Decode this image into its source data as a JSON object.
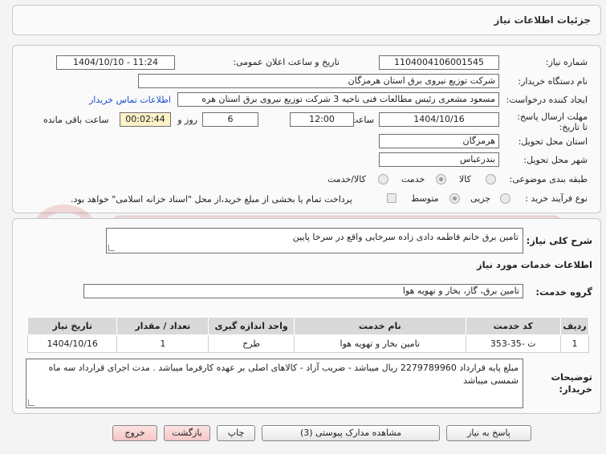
{
  "header": {
    "title": "جزئیات اطلاعات نیاز"
  },
  "fields": {
    "need_number_label": "شماره نیاز:",
    "need_number": "1104004106001545",
    "announce_label": "تاریخ و ساعت اعلان عمومی:",
    "announce_value": "1404/10/10 - 11:24",
    "buyer_org_label": "نام دستگاه خریدار:",
    "buyer_org": "شرکت توزیع نیروی برق استان هرمزگان",
    "creator_label": "ایجاد کننده درخواست:",
    "creator": "مسعود مشعری رئیس مطالعات فنی ناحیه 3 شرکت توزیع نیروی برق استان هره",
    "contact_link": "اطلاعات تماس خریدار",
    "deadline_label": "مهلت ارسال پاسخ: تا تاریخ:",
    "deadline_date": "1404/10/16",
    "time_label": "ساعت",
    "deadline_time": "12:00",
    "days_value": "6",
    "days_label": "روز و",
    "remaining_value": "00:02:44",
    "remaining_label": "ساعت باقی مانده",
    "province_label": "استان محل تحویل:",
    "province": "هرمزگان",
    "city_label": "شهر محل تحویل:",
    "city": "بندرعباس",
    "category_label": "طبقه بندی موضوعی:",
    "category_options": [
      "کالا",
      "خدمت",
      "کالا/خدمت"
    ],
    "process_label": "نوع فرآیند خرید :",
    "process_options": [
      "جزیی",
      "متوسط"
    ],
    "payment_note": "پرداخت تمام یا بخشی از مبلغ خرید،از محل \"اسناد خزانه اسلامی\" خواهد بود."
  },
  "summary": {
    "label": "شرح کلی نیاز:",
    "value": "تامین برق خانم فاطمه دادی زاده سرخایی واقع در سرخا پایین"
  },
  "services": {
    "section_title": "اطلاعات خدمات مورد نیاز",
    "group_label": "گروه خدمت:",
    "group_value": "تامین برق، گاز، بخار و تهویه هوا",
    "table": {
      "headers": [
        "ردیف",
        "کد خدمت",
        "نام خدمت",
        "واحد اندازه گیری",
        "تعداد / مقدار",
        "تاریخ نیاز"
      ],
      "rows": [
        [
          "1",
          "ت -35-353",
          "تامین بخار و تهویه هوا",
          "طرح",
          "1",
          "1404/10/16"
        ]
      ]
    }
  },
  "buyer_notes": {
    "label": "توضیحات خریدار:",
    "value": "مبلغ پایه قرارداد 2279789960 ریال میباشد - ضریب آزاد - کالاهای اصلی بر عهده کارفرما میباشد . مدت اجرای قرارداد سه ماه شمسی میباشد"
  },
  "buttons": {
    "reply": "پاسخ به نیاز",
    "attachments": "مشاهده مدارک پیوستی (3)",
    "print": "چاپ",
    "back": "بازگشت",
    "exit": "خروج"
  }
}
